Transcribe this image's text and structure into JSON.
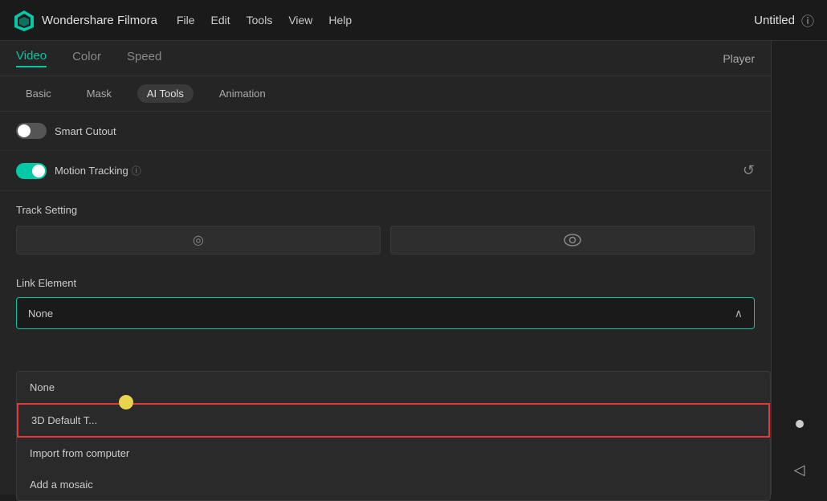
{
  "topbar": {
    "logo_text": "Wondershare Filmora",
    "nav": [
      {
        "label": "File"
      },
      {
        "label": "Edit"
      },
      {
        "label": "Tools"
      },
      {
        "label": "View"
      },
      {
        "label": "Help"
      }
    ],
    "project_title": "Untitled",
    "info_icon": "ⓘ"
  },
  "tabs_primary": [
    {
      "label": "Video",
      "active": true
    },
    {
      "label": "Color",
      "active": false
    },
    {
      "label": "Speed",
      "active": false
    }
  ],
  "player_label": "Player",
  "tabs_secondary": [
    {
      "label": "Basic",
      "active": false
    },
    {
      "label": "Mask",
      "active": false
    },
    {
      "label": "AI Tools",
      "active": true
    },
    {
      "label": "Animation",
      "active": false
    }
  ],
  "smart_cutout": {
    "label": "Smart Cutout",
    "toggle_state": "off"
  },
  "motion_tracking": {
    "label": "Motion Tracking",
    "toggle_state": "on",
    "help_symbol": "ⓘ",
    "reset_symbol": "↺"
  },
  "track_setting": {
    "label": "Track Setting",
    "btn1_icon": "◎",
    "btn2_icon": "👁"
  },
  "link_element": {
    "label": "Link Element",
    "selected": "None",
    "chevron": "∧"
  },
  "dropdown_items": [
    {
      "label": "None",
      "selected": false
    },
    {
      "label": "3D Default T...",
      "selected": true
    },
    {
      "label": "Import from computer",
      "selected": false
    },
    {
      "label": "Add a mosaic",
      "selected": false
    }
  ],
  "right_panel": {
    "dot_icon": "○",
    "arrow_icon": "◁"
  }
}
